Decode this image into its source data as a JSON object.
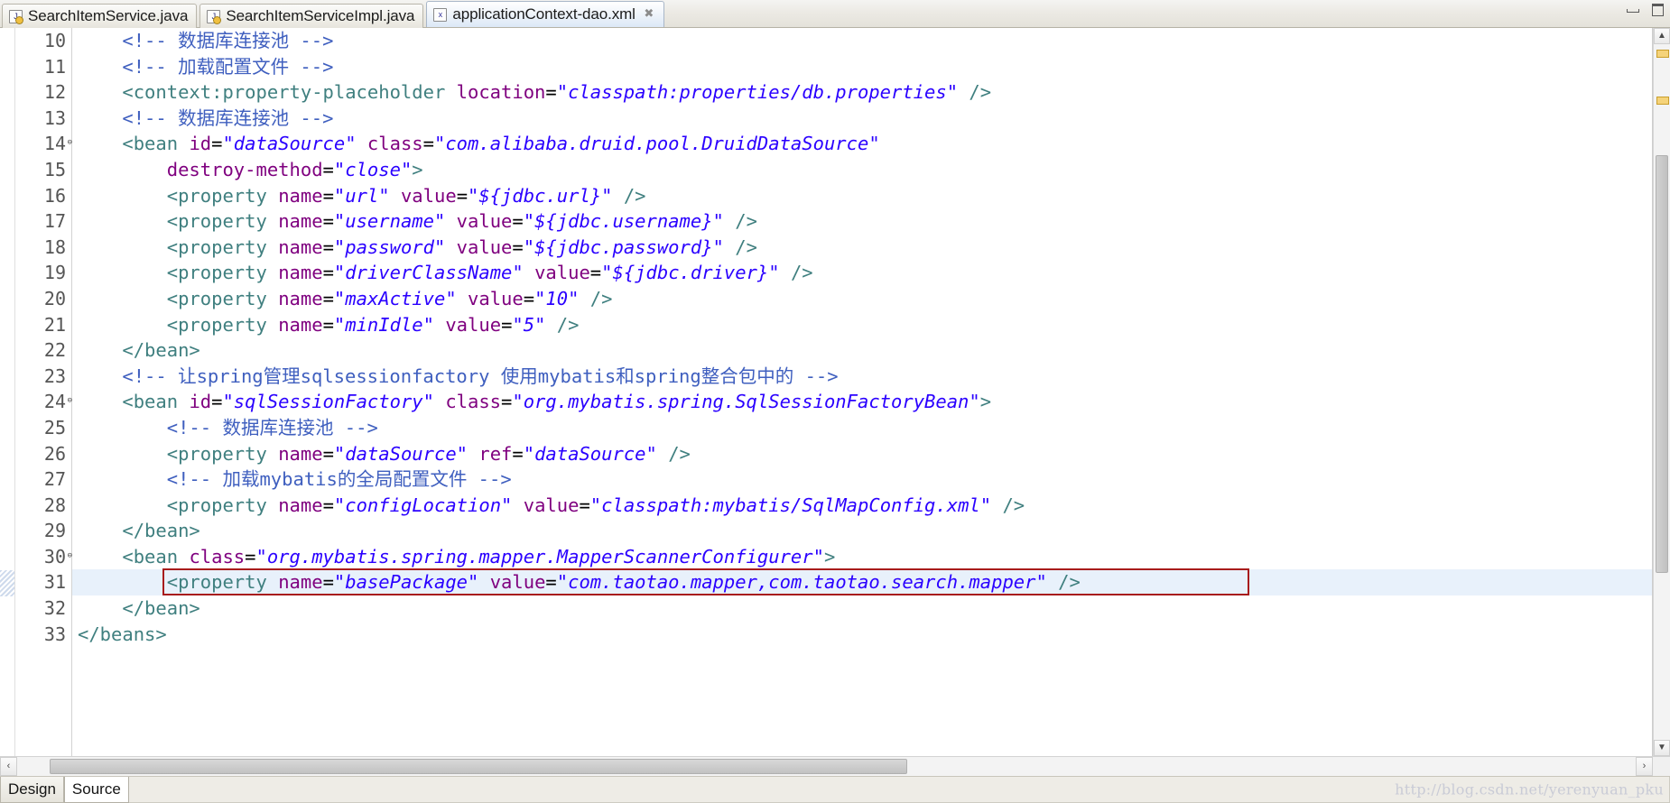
{
  "window": {
    "minimize_label": "minimize",
    "maximize_label": "restore"
  },
  "tabs": [
    {
      "label": "SearchItemService.java",
      "icon": "java-file-icon",
      "icon_glyph": "J",
      "active": false,
      "closable": false
    },
    {
      "label": "SearchItemServiceImpl.java",
      "icon": "java-file-icon",
      "icon_glyph": "J",
      "active": false,
      "closable": false
    },
    {
      "label": "applicationContext-dao.xml",
      "icon": "xml-file-icon",
      "icon_glyph": "x",
      "active": true,
      "closable": true,
      "close_glyph": "✖"
    }
  ],
  "editor": {
    "first_visible_line": 10,
    "highlighted_line": 31,
    "annotation": {
      "type": "red-rectangle",
      "line": 31,
      "color": "#a81c1c"
    },
    "lines": [
      {
        "n": 10,
        "fold": "",
        "tokens": [
          {
            "c": "cm",
            "t": "    <!-- 数据库连接池 -->"
          }
        ]
      },
      {
        "n": 11,
        "fold": "",
        "tokens": [
          {
            "c": "cm",
            "t": "    <!-- 加载配置文件 -->"
          }
        ]
      },
      {
        "n": 12,
        "fold": "",
        "tokens": [
          {
            "c": "br",
            "t": "    "
          },
          {
            "c": "tg",
            "t": "<context:property-placeholder"
          },
          {
            "c": "br",
            "t": " "
          },
          {
            "c": "at",
            "t": "location"
          },
          {
            "c": "eq",
            "t": "="
          },
          {
            "c": "st",
            "t": "\"classpath:properties/db.properties\""
          },
          {
            "c": "br",
            "t": " "
          },
          {
            "c": "tg",
            "t": "/>"
          }
        ]
      },
      {
        "n": 13,
        "fold": "",
        "tokens": [
          {
            "c": "cm",
            "t": "    <!-- 数据库连接池 -->"
          }
        ]
      },
      {
        "n": 14,
        "fold": "⊖",
        "tokens": [
          {
            "c": "br",
            "t": "    "
          },
          {
            "c": "tg",
            "t": "<bean"
          },
          {
            "c": "br",
            "t": " "
          },
          {
            "c": "at",
            "t": "id"
          },
          {
            "c": "eq",
            "t": "="
          },
          {
            "c": "st",
            "t": "\"dataSource\""
          },
          {
            "c": "br",
            "t": " "
          },
          {
            "c": "at",
            "t": "class"
          },
          {
            "c": "eq",
            "t": "="
          },
          {
            "c": "st",
            "t": "\"com.alibaba.druid.pool.DruidDataSource\""
          }
        ]
      },
      {
        "n": 15,
        "fold": "",
        "tokens": [
          {
            "c": "br",
            "t": "        "
          },
          {
            "c": "at",
            "t": "destroy-method"
          },
          {
            "c": "eq",
            "t": "="
          },
          {
            "c": "st",
            "t": "\"close\""
          },
          {
            "c": "tg",
            "t": ">"
          }
        ]
      },
      {
        "n": 16,
        "fold": "",
        "tokens": [
          {
            "c": "br",
            "t": "        "
          },
          {
            "c": "tg",
            "t": "<property"
          },
          {
            "c": "br",
            "t": " "
          },
          {
            "c": "at",
            "t": "name"
          },
          {
            "c": "eq",
            "t": "="
          },
          {
            "c": "st",
            "t": "\"url\""
          },
          {
            "c": "br",
            "t": " "
          },
          {
            "c": "at",
            "t": "value"
          },
          {
            "c": "eq",
            "t": "="
          },
          {
            "c": "st",
            "t": "\"${jdbc.url}\""
          },
          {
            "c": "br",
            "t": " "
          },
          {
            "c": "tg",
            "t": "/>"
          }
        ]
      },
      {
        "n": 17,
        "fold": "",
        "tokens": [
          {
            "c": "br",
            "t": "        "
          },
          {
            "c": "tg",
            "t": "<property"
          },
          {
            "c": "br",
            "t": " "
          },
          {
            "c": "at",
            "t": "name"
          },
          {
            "c": "eq",
            "t": "="
          },
          {
            "c": "st",
            "t": "\"username\""
          },
          {
            "c": "br",
            "t": " "
          },
          {
            "c": "at",
            "t": "value"
          },
          {
            "c": "eq",
            "t": "="
          },
          {
            "c": "st",
            "t": "\"${jdbc.username}\""
          },
          {
            "c": "br",
            "t": " "
          },
          {
            "c": "tg",
            "t": "/>"
          }
        ]
      },
      {
        "n": 18,
        "fold": "",
        "tokens": [
          {
            "c": "br",
            "t": "        "
          },
          {
            "c": "tg",
            "t": "<property"
          },
          {
            "c": "br",
            "t": " "
          },
          {
            "c": "at",
            "t": "name"
          },
          {
            "c": "eq",
            "t": "="
          },
          {
            "c": "st",
            "t": "\"password\""
          },
          {
            "c": "br",
            "t": " "
          },
          {
            "c": "at",
            "t": "value"
          },
          {
            "c": "eq",
            "t": "="
          },
          {
            "c": "st",
            "t": "\"${jdbc.password}\""
          },
          {
            "c": "br",
            "t": " "
          },
          {
            "c": "tg",
            "t": "/>"
          }
        ]
      },
      {
        "n": 19,
        "fold": "",
        "tokens": [
          {
            "c": "br",
            "t": "        "
          },
          {
            "c": "tg",
            "t": "<property"
          },
          {
            "c": "br",
            "t": " "
          },
          {
            "c": "at",
            "t": "name"
          },
          {
            "c": "eq",
            "t": "="
          },
          {
            "c": "st",
            "t": "\"driverClassName\""
          },
          {
            "c": "br",
            "t": " "
          },
          {
            "c": "at",
            "t": "value"
          },
          {
            "c": "eq",
            "t": "="
          },
          {
            "c": "st",
            "t": "\"${jdbc.driver}\""
          },
          {
            "c": "br",
            "t": " "
          },
          {
            "c": "tg",
            "t": "/>"
          }
        ]
      },
      {
        "n": 20,
        "fold": "",
        "tokens": [
          {
            "c": "br",
            "t": "        "
          },
          {
            "c": "tg",
            "t": "<property"
          },
          {
            "c": "br",
            "t": " "
          },
          {
            "c": "at",
            "t": "name"
          },
          {
            "c": "eq",
            "t": "="
          },
          {
            "c": "st",
            "t": "\"maxActive\""
          },
          {
            "c": "br",
            "t": " "
          },
          {
            "c": "at",
            "t": "value"
          },
          {
            "c": "eq",
            "t": "="
          },
          {
            "c": "st",
            "t": "\"10\""
          },
          {
            "c": "br",
            "t": " "
          },
          {
            "c": "tg",
            "t": "/>"
          }
        ]
      },
      {
        "n": 21,
        "fold": "",
        "tokens": [
          {
            "c": "br",
            "t": "        "
          },
          {
            "c": "tg",
            "t": "<property"
          },
          {
            "c": "br",
            "t": " "
          },
          {
            "c": "at",
            "t": "name"
          },
          {
            "c": "eq",
            "t": "="
          },
          {
            "c": "st",
            "t": "\"minIdle\""
          },
          {
            "c": "br",
            "t": " "
          },
          {
            "c": "at",
            "t": "value"
          },
          {
            "c": "eq",
            "t": "="
          },
          {
            "c": "st",
            "t": "\"5\""
          },
          {
            "c": "br",
            "t": " "
          },
          {
            "c": "tg",
            "t": "/>"
          }
        ]
      },
      {
        "n": 22,
        "fold": "",
        "tokens": [
          {
            "c": "br",
            "t": "    "
          },
          {
            "c": "tg",
            "t": "</bean>"
          }
        ]
      },
      {
        "n": 23,
        "fold": "",
        "tokens": [
          {
            "c": "cm",
            "t": "    <!-- 让spring管理sqlsessionfactory 使用mybatis和spring整合包中的 -->"
          }
        ]
      },
      {
        "n": 24,
        "fold": "⊖",
        "tokens": [
          {
            "c": "br",
            "t": "    "
          },
          {
            "c": "tg",
            "t": "<bean"
          },
          {
            "c": "br",
            "t": " "
          },
          {
            "c": "at",
            "t": "id"
          },
          {
            "c": "eq",
            "t": "="
          },
          {
            "c": "st",
            "t": "\"sqlSessionFactory\""
          },
          {
            "c": "br",
            "t": " "
          },
          {
            "c": "at",
            "t": "class"
          },
          {
            "c": "eq",
            "t": "="
          },
          {
            "c": "st",
            "t": "\"org.mybatis.spring.SqlSessionFactoryBean\""
          },
          {
            "c": "tg",
            "t": ">"
          }
        ]
      },
      {
        "n": 25,
        "fold": "",
        "tokens": [
          {
            "c": "cm",
            "t": "        <!-- 数据库连接池 -->"
          }
        ]
      },
      {
        "n": 26,
        "fold": "",
        "tokens": [
          {
            "c": "br",
            "t": "        "
          },
          {
            "c": "tg",
            "t": "<property"
          },
          {
            "c": "br",
            "t": " "
          },
          {
            "c": "at",
            "t": "name"
          },
          {
            "c": "eq",
            "t": "="
          },
          {
            "c": "st",
            "t": "\"dataSource\""
          },
          {
            "c": "br",
            "t": " "
          },
          {
            "c": "at",
            "t": "ref"
          },
          {
            "c": "eq",
            "t": "="
          },
          {
            "c": "st",
            "t": "\"dataSource\""
          },
          {
            "c": "br",
            "t": " "
          },
          {
            "c": "tg",
            "t": "/>"
          }
        ]
      },
      {
        "n": 27,
        "fold": "",
        "tokens": [
          {
            "c": "cm",
            "t": "        <!-- 加载mybatis的全局配置文件 -->"
          }
        ]
      },
      {
        "n": 28,
        "fold": "",
        "tokens": [
          {
            "c": "br",
            "t": "        "
          },
          {
            "c": "tg",
            "t": "<property"
          },
          {
            "c": "br",
            "t": " "
          },
          {
            "c": "at",
            "t": "name"
          },
          {
            "c": "eq",
            "t": "="
          },
          {
            "c": "st",
            "t": "\"configLocation\""
          },
          {
            "c": "br",
            "t": " "
          },
          {
            "c": "at",
            "t": "value"
          },
          {
            "c": "eq",
            "t": "="
          },
          {
            "c": "st",
            "t": "\"classpath:mybatis/SqlMapConfig.xml\""
          },
          {
            "c": "br",
            "t": " "
          },
          {
            "c": "tg",
            "t": "/>"
          }
        ]
      },
      {
        "n": 29,
        "fold": "",
        "tokens": [
          {
            "c": "br",
            "t": "    "
          },
          {
            "c": "tg",
            "t": "</bean>"
          }
        ]
      },
      {
        "n": 30,
        "fold": "⊖",
        "tokens": [
          {
            "c": "br",
            "t": "    "
          },
          {
            "c": "tg",
            "t": "<bean"
          },
          {
            "c": "br",
            "t": " "
          },
          {
            "c": "at",
            "t": "class"
          },
          {
            "c": "eq",
            "t": "="
          },
          {
            "c": "st",
            "t": "\"org.mybatis.spring.mapper.MapperScannerConfigurer\""
          },
          {
            "c": "tg",
            "t": ">"
          }
        ]
      },
      {
        "n": 31,
        "fold": "",
        "highlight": true,
        "tokens": [
          {
            "c": "br",
            "t": "        "
          },
          {
            "c": "tg",
            "t": "<property"
          },
          {
            "c": "br",
            "t": " "
          },
          {
            "c": "at",
            "t": "name"
          },
          {
            "c": "eq",
            "t": "="
          },
          {
            "c": "st",
            "t": "\"basePackage\""
          },
          {
            "c": "br",
            "t": " "
          },
          {
            "c": "at",
            "t": "value"
          },
          {
            "c": "eq",
            "t": "="
          },
          {
            "c": "st",
            "t": "\"com.taotao.mapper,com.taotao.search.mapper\""
          },
          {
            "c": "br",
            "t": " "
          },
          {
            "c": "tg",
            "t": "/>"
          }
        ]
      },
      {
        "n": 32,
        "fold": "",
        "tokens": [
          {
            "c": "br",
            "t": "    "
          },
          {
            "c": "tg",
            "t": "</bean>"
          }
        ]
      },
      {
        "n": 33,
        "fold": "",
        "tokens": [
          {
            "c": "tg",
            "t": "</beans>"
          }
        ]
      }
    ]
  },
  "scrollbars": {
    "vertical": {
      "up_glyph": "▲",
      "down_glyph": "▼",
      "thumb_top_pct": 16,
      "thumb_height_pct": 60
    },
    "horizontal": {
      "left_glyph": "‹",
      "right_glyph": "›",
      "thumb_left_pct": 2,
      "thumb_width_pct": 53
    }
  },
  "bottom_tabs": [
    {
      "label": "Design",
      "active": false
    },
    {
      "label": "Source",
      "active": true
    }
  ],
  "watermark": {
    "text": "http://blog.csdn.net/yerenyuan_pku"
  },
  "colors": {
    "tag": "#3f7f7f",
    "attribute": "#7f007f",
    "string": "#2a00ff",
    "comment": "#3f5fbf",
    "highlight_row": "#e8f1fb",
    "annotation_box": "#a81c1c"
  }
}
